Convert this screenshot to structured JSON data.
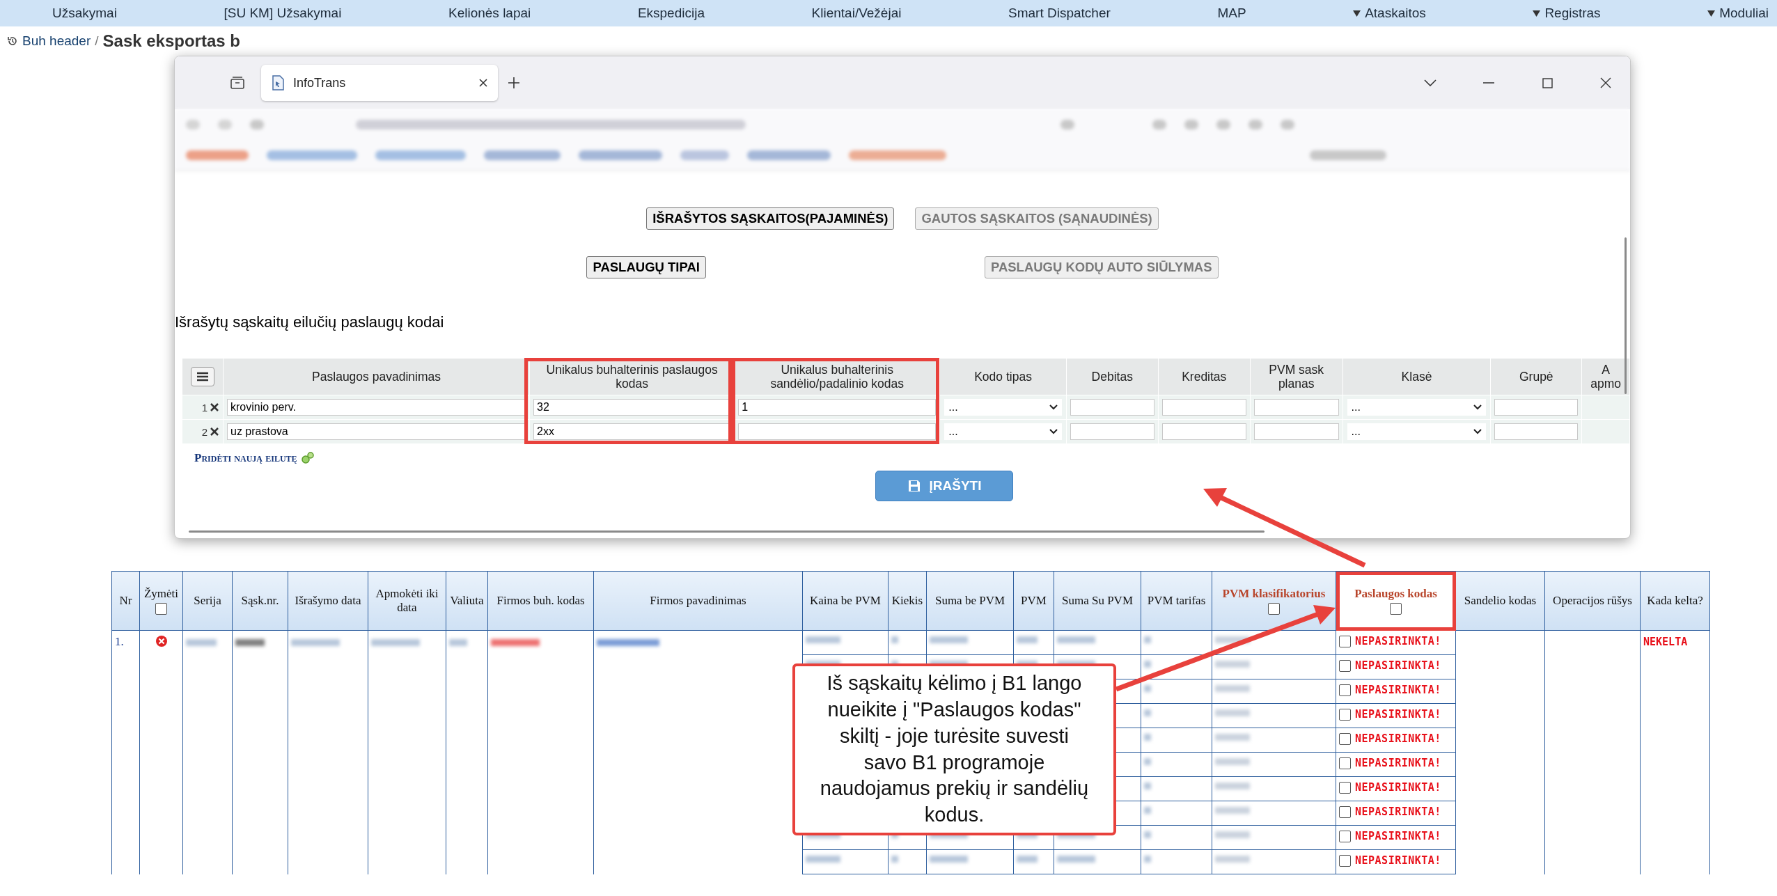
{
  "menu": [
    {
      "label": "Užsakymai",
      "dropdown": false
    },
    {
      "label": "[SU KM] Užsakymai",
      "dropdown": false
    },
    {
      "label": "Kelionės lapai",
      "dropdown": false
    },
    {
      "label": "Ekspedicija",
      "dropdown": false
    },
    {
      "label": "Klientai/Vežėjai",
      "dropdown": false
    },
    {
      "label": "Smart Dispatcher",
      "dropdown": false
    },
    {
      "label": "MAP",
      "dropdown": false
    },
    {
      "label": "Ataskaitos",
      "dropdown": true
    },
    {
      "label": "Registras",
      "dropdown": true
    },
    {
      "label": "Moduliai",
      "dropdown": true
    }
  ],
  "breadcrumb": {
    "link": "Buh header",
    "separator": "/",
    "title": "Sask eksportas b"
  },
  "browser": {
    "tab": {
      "title": "InfoTrans"
    }
  },
  "page": {
    "mode_buttons": [
      {
        "label": "IŠRAŠYTOS SĄSKAITOS(PAJAMINĖS)",
        "selected": true
      },
      {
        "label": "GAUTOS SĄSKAITOS (SĄNAUDINĖS)",
        "selected": false
      }
    ],
    "sub_buttons": [
      {
        "label": "PASLAUGŲ TIPAI",
        "selected": true
      },
      {
        "label": "PASLAUGŲ KODŲ AUTO SIŪLYMAS",
        "selected": false
      }
    ],
    "heading": "Išrašytų sąskaitų eilučių paslaugų kodai",
    "table": {
      "columns": [
        {
          "label": "Paslaugos pavadinimas",
          "highlighted": false
        },
        {
          "label": "Unikalus buhalterinis paslaugos kodas",
          "highlighted": true
        },
        {
          "label": "Unikalus buhalterinis sandėlio/padalinio kodas",
          "highlighted": true
        },
        {
          "label": "Kodo tipas",
          "highlighted": false
        },
        {
          "label": "Debitas",
          "highlighted": false
        },
        {
          "label": "Kreditas",
          "highlighted": false
        },
        {
          "label": "PVM sask planas",
          "highlighted": false
        },
        {
          "label": "Klasė",
          "highlighted": false
        },
        {
          "label": "Grupė",
          "highlighted": false
        },
        {
          "label": "A apmo",
          "highlighted": false
        }
      ],
      "rows": [
        {
          "number": "1",
          "cells": [
            {
              "kind": "text",
              "value": "krovinio perv."
            },
            {
              "kind": "text",
              "value": "32"
            },
            {
              "kind": "text",
              "value": "1"
            },
            {
              "kind": "select",
              "value": "..."
            },
            {
              "kind": "text"
            },
            {
              "kind": "text"
            },
            {
              "kind": "text"
            },
            {
              "kind": "select",
              "value": "..."
            },
            {
              "kind": "text"
            },
            {
              "kind": "blank"
            }
          ]
        },
        {
          "number": "2",
          "cells": [
            {
              "kind": "text",
              "value": "uz prastova"
            },
            {
              "kind": "text",
              "value": "2xx"
            },
            {
              "kind": "text"
            },
            {
              "kind": "select",
              "value": "..."
            },
            {
              "kind": "text"
            },
            {
              "kind": "text"
            },
            {
              "kind": "text"
            },
            {
              "kind": "select",
              "value": "..."
            },
            {
              "kind": "text"
            },
            {
              "kind": "blank"
            }
          ]
        }
      ]
    },
    "add_row_link": "Pridėti naują eilutę",
    "save_button": "ĮRAŠYTI"
  },
  "invoices": {
    "columns": [
      {
        "label": "Nr",
        "accent": false,
        "highlighted": false
      },
      {
        "label": "Žymėti",
        "accent": false,
        "highlighted": false,
        "checkbox": {
          "checked": false
        }
      },
      {
        "label": "Serija",
        "accent": false,
        "highlighted": false
      },
      {
        "label": "Sąsk.nr.",
        "accent": false,
        "highlighted": false
      },
      {
        "label": "Išrašymo data",
        "accent": false,
        "highlighted": false
      },
      {
        "label": "Apmokėti iki data",
        "accent": false,
        "highlighted": false
      },
      {
        "label": "Valiuta",
        "accent": false,
        "highlighted": false
      },
      {
        "label": "Firmos buh. kodas",
        "accent": false,
        "highlighted": false
      },
      {
        "label": "Firmos pavadinimas",
        "accent": false,
        "highlighted": false
      },
      {
        "label": "Kaina be PVM",
        "accent": false,
        "highlighted": false
      },
      {
        "label": "Kiekis",
        "accent": false,
        "highlighted": false
      },
      {
        "label": "Suma be PVM",
        "accent": false,
        "highlighted": false
      },
      {
        "label": "PVM",
        "accent": false,
        "highlighted": false
      },
      {
        "label": "Suma Su PVM",
        "accent": false,
        "highlighted": false
      },
      {
        "label": "PVM tarifas",
        "accent": false,
        "highlighted": false
      },
      {
        "label": "PVM klasifikatorius",
        "accent": true,
        "highlighted": false,
        "checkbox": {
          "checked": false
        }
      },
      {
        "label": "Paslaugos kodas",
        "accent": true,
        "highlighted": true,
        "checkbox": {
          "checked": false
        }
      },
      {
        "label": "Sandelio kodas",
        "accent": false,
        "highlighted": false
      },
      {
        "label": "Operacijos rūšys",
        "accent": false,
        "highlighted": false
      },
      {
        "label": "Kada kelta?",
        "accent": false,
        "highlighted": false
      }
    ],
    "rows": [
      {
        "nr": "1.",
        "error": true,
        "kada_kelta": "NEKELTA",
        "lines": [
          {
            "checked": false,
            "service_code": "NEPASIRINKTA!"
          },
          {
            "checked": false,
            "service_code": "NEPASIRINKTA!"
          },
          {
            "checked": false,
            "service_code": "NEPASIRINKTA!"
          },
          {
            "checked": false,
            "service_code": "NEPASIRINKTA!"
          },
          {
            "checked": false,
            "service_code": "NEPASIRINKTA!"
          },
          {
            "checked": false,
            "service_code": "NEPASIRINKTA!"
          },
          {
            "checked": false,
            "service_code": "NEPASIRINKTA!"
          },
          {
            "checked": false,
            "service_code": "NEPASIRINKTA!"
          },
          {
            "checked": false,
            "service_code": "NEPASIRINKTA!"
          },
          {
            "checked": false,
            "service_code": "NEPASIRINKTA!"
          }
        ]
      }
    ]
  },
  "callout": {
    "text": "Iš sąskaitų kėlimo į B1 lango nueikite į \"Paslaugos kodas\" skiltį - joje turėsite suvesti savo B1 programoje naudojamus prekių ir sandėlių kodus."
  }
}
